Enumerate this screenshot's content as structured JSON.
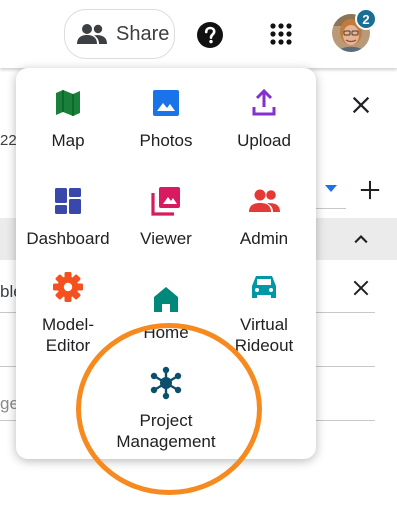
{
  "header": {
    "share_label": "Share",
    "share_icon": "people-icon",
    "help_icon": "help-circle-icon",
    "apps_icon": "apps-grid-icon",
    "notification_count": "2",
    "accent_color": "#1a6e93"
  },
  "background": {
    "frag_22": "22",
    "frag_ble": "ble",
    "frag_ge": "ge"
  },
  "apps_menu": {
    "items": [
      {
        "label": "Map",
        "icon": "map-icon",
        "color": "#188038"
      },
      {
        "label": "Photos",
        "icon": "photo-icon",
        "color": "#1a73e8"
      },
      {
        "label": "Upload",
        "icon": "upload-icon",
        "color": "#8430ce"
      },
      {
        "label": "Dashboard",
        "icon": "dashboard-icon",
        "color": "#3949ab"
      },
      {
        "label": "Viewer",
        "icon": "photo-library-icon",
        "color": "#d81b60"
      },
      {
        "label": "Admin",
        "icon": "people-icon",
        "color": "#e53935"
      },
      {
        "label": "Model-\nEditor",
        "icon": "gear-icon",
        "color": "#f4511e"
      },
      {
        "label": "Home",
        "icon": "home-icon",
        "color": "#00897b"
      },
      {
        "label": "Virtual\nRideout",
        "icon": "car-icon",
        "color": "#0097a7"
      },
      {
        "label": "Project\nManagement",
        "icon": "hub-network-icon",
        "color": "#0b4f6c"
      }
    ]
  },
  "highlight_color": "#f68a1f"
}
